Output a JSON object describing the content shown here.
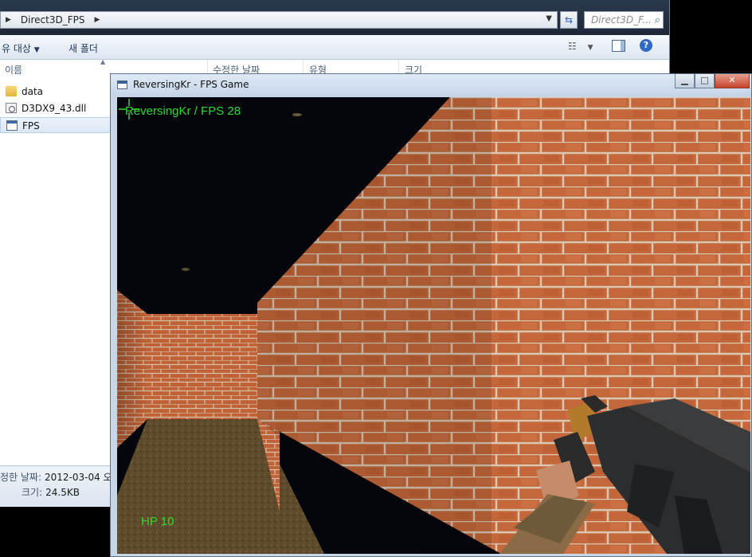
{
  "explorer": {
    "breadcrumb": [
      "Direct3D_FPS"
    ],
    "search_placeholder": "Direct3D_F...",
    "toolbar": {
      "organize_label": "유 대상",
      "new_folder_label": "새 폴더"
    },
    "columns": [
      "이름",
      "수정한 날짜",
      "유형",
      "크기"
    ],
    "files": [
      {
        "name": "data",
        "icon": "folder-icon"
      },
      {
        "name": "D3DX9_43.dll",
        "icon": "dll-file-icon"
      },
      {
        "name": "FPS",
        "icon": "exe-file-icon"
      }
    ],
    "details": {
      "date_label": "정한 날짜:",
      "date_value": "2012-03-04 오",
      "size_label": "크기:",
      "size_value": "24.5KB"
    }
  },
  "game": {
    "title": "ReversingKr - FPS Game",
    "hud_fps": "ReversingKr / FPS 28",
    "hud_hp": "HP 10",
    "hud_color": "#2fd82f"
  }
}
